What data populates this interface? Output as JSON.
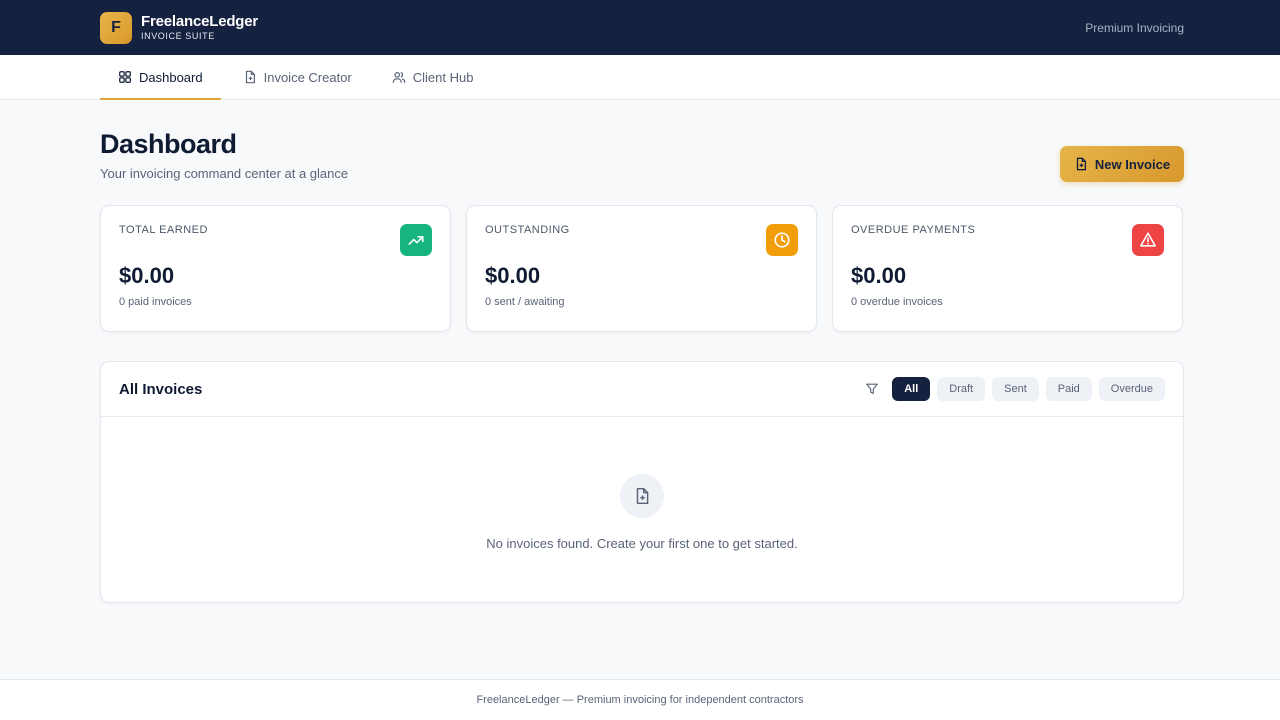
{
  "header": {
    "logo_letter": "F",
    "brand_name": "FreelanceLedger",
    "brand_sub": "INVOICE SUITE",
    "right_text": "Premium Invoicing"
  },
  "nav": {
    "tabs": [
      {
        "label": "Dashboard",
        "icon": "grid-icon",
        "active": true
      },
      {
        "label": "Invoice Creator",
        "icon": "file-plus-icon",
        "active": false
      },
      {
        "label": "Client Hub",
        "icon": "users-icon",
        "active": false
      }
    ]
  },
  "page": {
    "title": "Dashboard",
    "subtitle": "Your invoicing command center at a glance",
    "new_invoice_label": "New Invoice"
  },
  "stats": [
    {
      "label": "TOTAL EARNED",
      "value": "$0.00",
      "note": "0 paid invoices",
      "icon": "trending-up-icon",
      "color": "#16b47e"
    },
    {
      "label": "OUTSTANDING",
      "value": "$0.00",
      "note": "0 sent / awaiting",
      "icon": "clock-icon",
      "color": "#f29e0c"
    },
    {
      "label": "OVERDUE PAYMENTS",
      "value": "$0.00",
      "note": "0 overdue invoices",
      "icon": "alert-triangle-icon",
      "color": "#ee4444"
    }
  ],
  "invoices": {
    "title": "All Invoices",
    "filters": [
      "All",
      "Draft",
      "Sent",
      "Paid",
      "Overdue"
    ],
    "active_filter": "All",
    "empty_text": "No invoices found. Create your first one to get started."
  },
  "footer": {
    "text": "FreelanceLedger — Premium invoicing for independent contractors"
  },
  "colors": {
    "header_bg": "#14213f",
    "accent": "#e0a53a"
  }
}
